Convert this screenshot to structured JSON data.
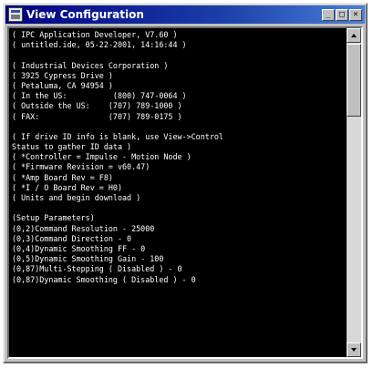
{
  "window": {
    "title": "View Configuration",
    "minimize_glyph": "_",
    "maximize_glyph": "□",
    "close_glyph": "×"
  },
  "console": {
    "lines": [
      "( IPC Application Developer, V7.60 )",
      "( untitled.ide, 05-22-2001, 14:16:44 )",
      "",
      "( Industrial Devices Corporation )",
      "( 3925 Cypress Drive )",
      "( Petaluma, CA 94954 )",
      "( In the US:          (800) 747-0064 )",
      "( Outside the US:    (707) 789-1000 )",
      "( FAX:               (707) 789-0175 )",
      "",
      "( If drive ID info is blank, use View->Control",
      "Status to gather ID data )",
      "( *Controller = Impulse - Motion Node )",
      "( *Firmware Revision = v60.47)",
      "( *Amp Board Rev = F8)",
      "( *I / O Board Rev = H0)",
      "( Units and begin download )",
      "",
      "(Setup Parameters)",
      "(0,2)Command Resolution - 25000",
      "(0,3)Command Direction - 0",
      "(0,4)Dynamic Smoothing FF - 0",
      "(0,5)Dynamic Smoothing Gain - 100",
      "(0,87)Multi-Stepping ( Disabled ) - 0",
      "(0,87)Dynamic Smoothing ( Disabled ) - 0"
    ]
  }
}
